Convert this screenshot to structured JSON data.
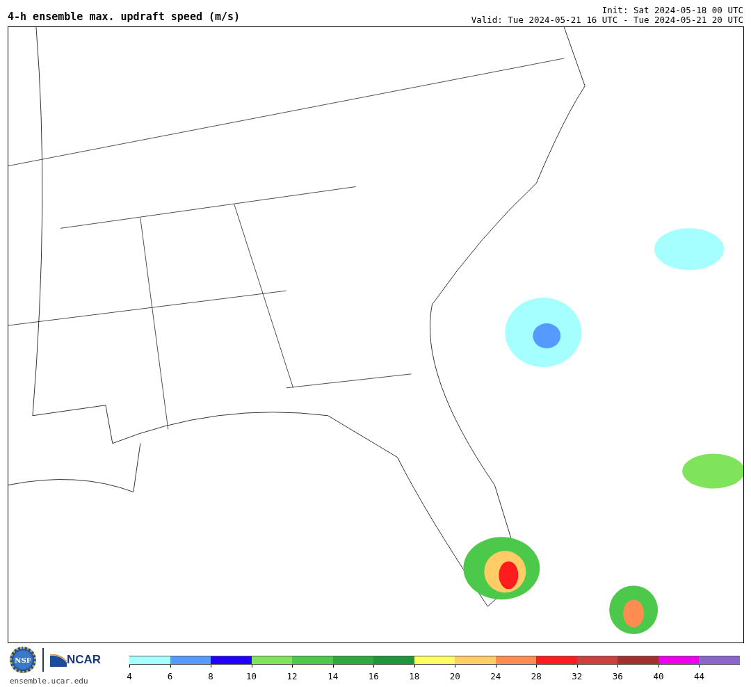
{
  "header": {
    "title": "4-h ensemble max. updraft speed (m/s)",
    "init": "Init: Sat 2024-05-18 00 UTC",
    "valid": "Valid: Tue 2024-05-21 16 UTC - Tue 2024-05-21 20 UTC"
  },
  "footer": {
    "logo_left": "NSF",
    "logo_right": "NCAR",
    "site": "ensemble.ucar.edu"
  },
  "colorbar": [
    {
      "label": "4",
      "color": "#a6ffff"
    },
    {
      "label": "6",
      "color": "#559bff"
    },
    {
      "label": "8",
      "color": "#2200ff"
    },
    {
      "label": "10",
      "color": "#80e35c"
    },
    {
      "label": "12",
      "color": "#4cc84a"
    },
    {
      "label": "14",
      "color": "#2eaa3c"
    },
    {
      "label": "16",
      "color": "#1e963c"
    },
    {
      "label": "18",
      "color": "#ffff60"
    },
    {
      "label": "20",
      "color": "#ffcc66"
    },
    {
      "label": "24",
      "color": "#ff8c50"
    },
    {
      "label": "28",
      "color": "#ff1c1c"
    },
    {
      "label": "32",
      "color": "#cc4040"
    },
    {
      "label": "36",
      "color": "#a33030"
    },
    {
      "label": "40",
      "color": "#ee00ee"
    },
    {
      "label": "44",
      "color": "#8866cc"
    }
  ]
}
